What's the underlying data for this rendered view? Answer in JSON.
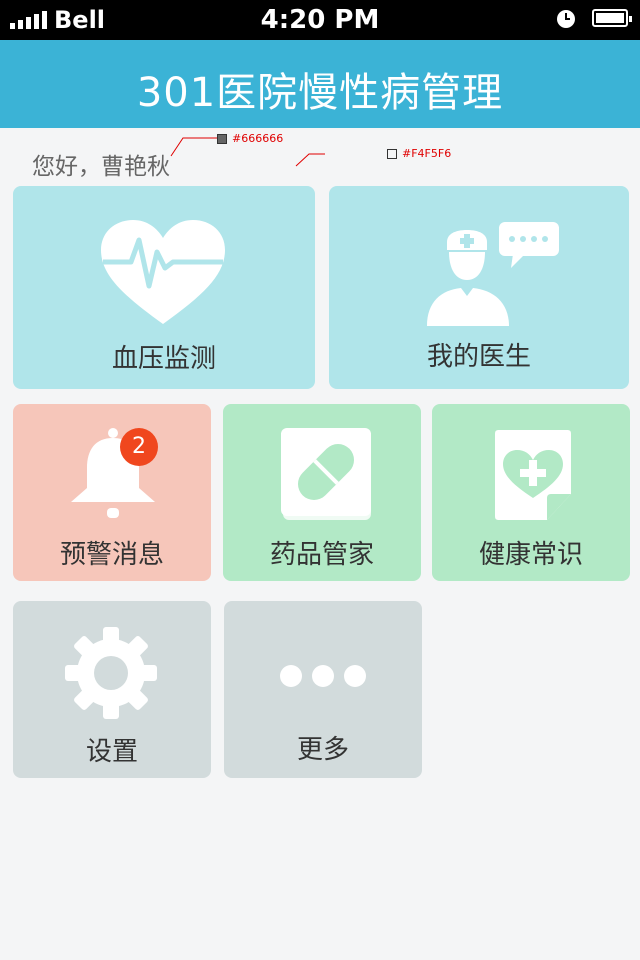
{
  "statusbar": {
    "carrier": "Bell",
    "time": "4:20 PM"
  },
  "header": {
    "title": "301医院慢性病管理"
  },
  "greeting": "您好，曹艳秋",
  "annotations": {
    "text_color": "#666666",
    "bg_color": "#F4F5F6"
  },
  "tiles": [
    {
      "label": "血压监测",
      "icon": "heart-pulse-icon",
      "color": "#B0E5EA"
    },
    {
      "label": "我的医生",
      "icon": "doctor-chat-icon",
      "color": "#B0E5EA"
    },
    {
      "label": "预警消息",
      "icon": "bell-icon",
      "color": "#F6C6BA",
      "badge": "2"
    },
    {
      "label": "药品管家",
      "icon": "pill-icon",
      "color": "#B2E9C6"
    },
    {
      "label": "健康常识",
      "icon": "health-doc-icon",
      "color": "#B2E9C6"
    },
    {
      "label": "设置",
      "icon": "gear-icon",
      "color": "#D2DBDC"
    },
    {
      "label": "更多",
      "icon": "more-icon",
      "color": "#D2DBDC"
    }
  ],
  "colors": {
    "header": "#3BB3D6",
    "background": "#F4F5F6",
    "badge": "#F0471E"
  }
}
